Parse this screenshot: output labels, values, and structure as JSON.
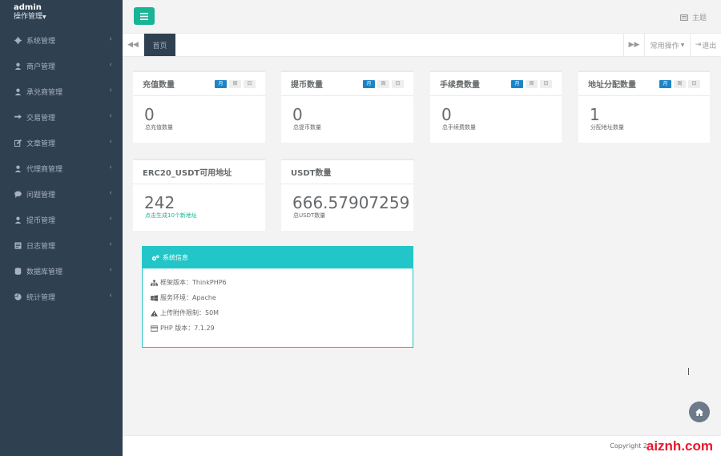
{
  "profile": {
    "name": "admin",
    "role": "操作管理"
  },
  "sidebar": {
    "items": [
      {
        "label": "系统管理",
        "icon": "gear-icon"
      },
      {
        "label": "商户管理",
        "icon": "user-icon"
      },
      {
        "label": "承兑商管理",
        "icon": "user-icon"
      },
      {
        "label": "交易管理",
        "icon": "exchange-icon"
      },
      {
        "label": "文章管理",
        "icon": "edit-icon"
      },
      {
        "label": "代理商管理",
        "icon": "user-icon"
      },
      {
        "label": "问题管理",
        "icon": "chat-icon"
      },
      {
        "label": "提币管理",
        "icon": "user-icon"
      },
      {
        "label": "日志管理",
        "icon": "log-icon"
      },
      {
        "label": "数据库管理",
        "icon": "database-icon"
      },
      {
        "label": "统计管理",
        "icon": "pie-icon"
      }
    ]
  },
  "topbar": {
    "theme_label": "主题"
  },
  "tabs": {
    "active": "首页",
    "ops_label": "常用操作",
    "exit_label": "退出"
  },
  "period_pills": [
    "月",
    "周",
    "日"
  ],
  "cards": [
    {
      "title": "充值数量",
      "value": "0",
      "desc": "总充值数量"
    },
    {
      "title": "提币数量",
      "value": "0",
      "desc": "总提币数量"
    },
    {
      "title": "手续费数量",
      "value": "0",
      "desc": "总手续费数量"
    },
    {
      "title": "地址分配数量",
      "value": "1",
      "desc": "分配地址数量"
    },
    {
      "title": "ERC20_USDT可用地址",
      "value": "242",
      "desc": "点击生成10个新地址"
    },
    {
      "title": "USDT数量",
      "value": "666.57907259",
      "desc": "总USDT数量"
    }
  ],
  "system_info": {
    "title": "系统信息",
    "rows": [
      {
        "label": "框架版本：ThinkPHP6",
        "icon": "sitemap-icon"
      },
      {
        "label": "服务环境：Apache",
        "icon": "windows-icon"
      },
      {
        "label": "上传附件限制：50M",
        "icon": "warning-icon"
      },
      {
        "label": "PHP 版本：7.1.29",
        "icon": "card-icon"
      }
    ]
  },
  "footer": {
    "copyright": "Copyright 2",
    "brand": "aiznh.com"
  },
  "colors": {
    "sidebar": "#2f4050",
    "primary": "#1ab394",
    "info": "#23c6c8",
    "pill_active": "#1c84c6",
    "brand": "#e8192c"
  }
}
